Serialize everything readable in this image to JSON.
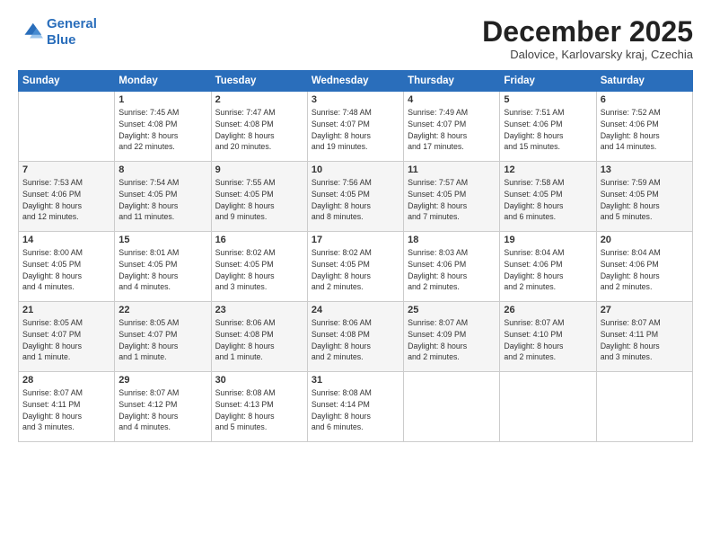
{
  "header": {
    "logo_line1": "General",
    "logo_line2": "Blue",
    "month_title": "December 2025",
    "location": "Dalovice, Karlovarsky kraj, Czechia"
  },
  "days_of_week": [
    "Sunday",
    "Monday",
    "Tuesday",
    "Wednesday",
    "Thursday",
    "Friday",
    "Saturday"
  ],
  "weeks": [
    [
      {
        "day": "",
        "text": ""
      },
      {
        "day": "1",
        "text": "Sunrise: 7:45 AM\nSunset: 4:08 PM\nDaylight: 8 hours\nand 22 minutes."
      },
      {
        "day": "2",
        "text": "Sunrise: 7:47 AM\nSunset: 4:08 PM\nDaylight: 8 hours\nand 20 minutes."
      },
      {
        "day": "3",
        "text": "Sunrise: 7:48 AM\nSunset: 4:07 PM\nDaylight: 8 hours\nand 19 minutes."
      },
      {
        "day": "4",
        "text": "Sunrise: 7:49 AM\nSunset: 4:07 PM\nDaylight: 8 hours\nand 17 minutes."
      },
      {
        "day": "5",
        "text": "Sunrise: 7:51 AM\nSunset: 4:06 PM\nDaylight: 8 hours\nand 15 minutes."
      },
      {
        "day": "6",
        "text": "Sunrise: 7:52 AM\nSunset: 4:06 PM\nDaylight: 8 hours\nand 14 minutes."
      }
    ],
    [
      {
        "day": "7",
        "text": "Sunrise: 7:53 AM\nSunset: 4:06 PM\nDaylight: 8 hours\nand 12 minutes."
      },
      {
        "day": "8",
        "text": "Sunrise: 7:54 AM\nSunset: 4:05 PM\nDaylight: 8 hours\nand 11 minutes."
      },
      {
        "day": "9",
        "text": "Sunrise: 7:55 AM\nSunset: 4:05 PM\nDaylight: 8 hours\nand 9 minutes."
      },
      {
        "day": "10",
        "text": "Sunrise: 7:56 AM\nSunset: 4:05 PM\nDaylight: 8 hours\nand 8 minutes."
      },
      {
        "day": "11",
        "text": "Sunrise: 7:57 AM\nSunset: 4:05 PM\nDaylight: 8 hours\nand 7 minutes."
      },
      {
        "day": "12",
        "text": "Sunrise: 7:58 AM\nSunset: 4:05 PM\nDaylight: 8 hours\nand 6 minutes."
      },
      {
        "day": "13",
        "text": "Sunrise: 7:59 AM\nSunset: 4:05 PM\nDaylight: 8 hours\nand 5 minutes."
      }
    ],
    [
      {
        "day": "14",
        "text": "Sunrise: 8:00 AM\nSunset: 4:05 PM\nDaylight: 8 hours\nand 4 minutes."
      },
      {
        "day": "15",
        "text": "Sunrise: 8:01 AM\nSunset: 4:05 PM\nDaylight: 8 hours\nand 4 minutes."
      },
      {
        "day": "16",
        "text": "Sunrise: 8:02 AM\nSunset: 4:05 PM\nDaylight: 8 hours\nand 3 minutes."
      },
      {
        "day": "17",
        "text": "Sunrise: 8:02 AM\nSunset: 4:05 PM\nDaylight: 8 hours\nand 2 minutes."
      },
      {
        "day": "18",
        "text": "Sunrise: 8:03 AM\nSunset: 4:06 PM\nDaylight: 8 hours\nand 2 minutes."
      },
      {
        "day": "19",
        "text": "Sunrise: 8:04 AM\nSunset: 4:06 PM\nDaylight: 8 hours\nand 2 minutes."
      },
      {
        "day": "20",
        "text": "Sunrise: 8:04 AM\nSunset: 4:06 PM\nDaylight: 8 hours\nand 2 minutes."
      }
    ],
    [
      {
        "day": "21",
        "text": "Sunrise: 8:05 AM\nSunset: 4:07 PM\nDaylight: 8 hours\nand 1 minute."
      },
      {
        "day": "22",
        "text": "Sunrise: 8:05 AM\nSunset: 4:07 PM\nDaylight: 8 hours\nand 1 minute."
      },
      {
        "day": "23",
        "text": "Sunrise: 8:06 AM\nSunset: 4:08 PM\nDaylight: 8 hours\nand 1 minute."
      },
      {
        "day": "24",
        "text": "Sunrise: 8:06 AM\nSunset: 4:08 PM\nDaylight: 8 hours\nand 2 minutes."
      },
      {
        "day": "25",
        "text": "Sunrise: 8:07 AM\nSunset: 4:09 PM\nDaylight: 8 hours\nand 2 minutes."
      },
      {
        "day": "26",
        "text": "Sunrise: 8:07 AM\nSunset: 4:10 PM\nDaylight: 8 hours\nand 2 minutes."
      },
      {
        "day": "27",
        "text": "Sunrise: 8:07 AM\nSunset: 4:11 PM\nDaylight: 8 hours\nand 3 minutes."
      }
    ],
    [
      {
        "day": "28",
        "text": "Sunrise: 8:07 AM\nSunset: 4:11 PM\nDaylight: 8 hours\nand 3 minutes."
      },
      {
        "day": "29",
        "text": "Sunrise: 8:07 AM\nSunset: 4:12 PM\nDaylight: 8 hours\nand 4 minutes."
      },
      {
        "day": "30",
        "text": "Sunrise: 8:08 AM\nSunset: 4:13 PM\nDaylight: 8 hours\nand 5 minutes."
      },
      {
        "day": "31",
        "text": "Sunrise: 8:08 AM\nSunset: 4:14 PM\nDaylight: 8 hours\nand 6 minutes."
      },
      {
        "day": "",
        "text": ""
      },
      {
        "day": "",
        "text": ""
      },
      {
        "day": "",
        "text": ""
      }
    ]
  ]
}
